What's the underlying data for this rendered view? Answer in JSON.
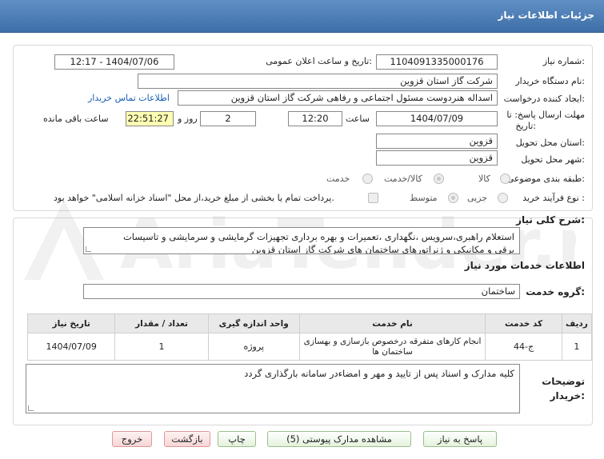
{
  "header": {
    "title": "جزئیات اطلاعات نیاز"
  },
  "watermark": "AriaTender.net",
  "form": {
    "need_number_label": "شماره نیاز:",
    "need_number": "1104091335000176",
    "announce_label": "تاریخ و ساعت اعلان عمومی:",
    "announce_value": "1404/07/06 - 12:17",
    "buyer_org_label": "نام دستگاه خریدار:",
    "buyer_org": "شرکت گاز استان قزوین",
    "creator_label": "ایجاد کننده درخواست:",
    "creator": "اسداله هنردوست مسئول اجتماعی و رفاهی شرکت گاز استان قزوین",
    "contact_link": "اطلاعات تماس خریدار",
    "deadline_label_1": "مهلت ارسال پاسخ: تا",
    "deadline_label_2": "تاریخ:",
    "deadline_date": "1404/07/09",
    "time_label": "ساعت",
    "deadline_time": "12:20",
    "days_value": "2",
    "days_label": "روز و",
    "remaining_time": "22:51:27",
    "remaining_label": "ساعت باقی مانده",
    "province_label": "استان محل تحویل:",
    "province": "قزوین",
    "city_label": "شهر محل تحویل:",
    "city": "قزوین",
    "category_label": "طبقه بندی موضوعی:",
    "category_options": [
      "کالا",
      "کالا/خدمت",
      "خدمت"
    ],
    "process_label": "نوع فرآیند خرید :",
    "process_options": [
      "جزیی",
      "متوسط"
    ],
    "payment_note": "پرداخت تمام یا بخشی از مبلغ خرید،از محل \"اسناد خزانه اسلامی\" خواهد بود."
  },
  "details": {
    "summary_label": "شرح کلی نیاز:",
    "summary_line1": "استعلام راهبری،سرویس ،نگهداری ،تعمیرات و بهره برداری تجهیزات گرمایشی و سرمایشی و تاسیسات",
    "summary_line2": "برقی و مکانیکی و ژنراتورهای ساختمان های شرکت گاز استان قزوین",
    "services_heading": "اطلاعات خدمات مورد نیاز",
    "group_label": "گروه خدمت:",
    "group_value": "ساختمان",
    "table": {
      "headers": [
        "ردیف",
        "کد خدمت",
        "نام خدمت",
        "واحد اندازه گیری",
        "تعداد / مقدار",
        "تاریخ نیاز"
      ],
      "rows": [
        [
          "1",
          "ج-44",
          "انجام کارهای متفرقه درخصوص بازسازی و بهسازی ساختمان ها",
          "پروژه",
          "1",
          "1404/07/09"
        ]
      ]
    },
    "notes_label_1": "توضیحات",
    "notes_label_2": "خریدار:",
    "notes_value": "کلیه مدارک و اسناد پس از تایید و مهر و امضاءدر سامانه بارگذاری گردد"
  },
  "buttons": {
    "reply": "پاسخ به نیاز",
    "attachments": "مشاهده مدارک پیوستی (5)",
    "print": "چاپ",
    "back": "بازگشت",
    "exit": "خروج"
  }
}
